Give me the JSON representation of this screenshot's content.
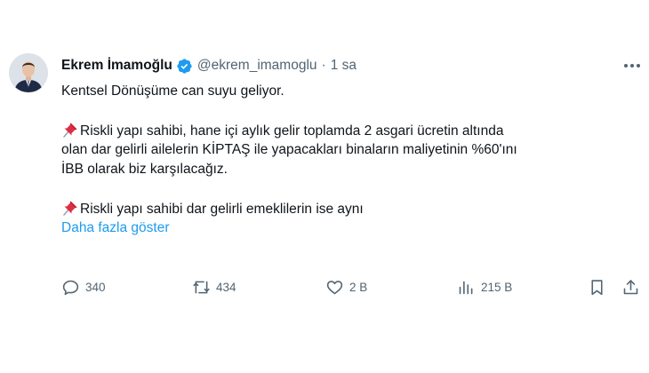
{
  "author": {
    "display_name": "Ekrem İmamoğlu",
    "handle": "@ekrem_imamoglu",
    "separator": "·",
    "time": "1 sa",
    "verified": true,
    "verified_color": "#1d9bf0"
  },
  "body": {
    "line1": "Kentsel Dönüşüme can suyu geliyor.",
    "line2": "Riskli yapı sahibi, hane içi aylık gelir toplamda 2 asgari ücretin altında",
    "line3": "olan dar gelirli ailelerin KİPTAŞ ile yapacakları binaların maliyetinin %60'ını",
    "line4": "İBB olarak biz karşılacağız.",
    "line5": "Riskli yapı sahibi dar gelirli emeklilerin ise aynı",
    "show_more": "Daha fazla göster",
    "pin_icon": "pushpin-icon"
  },
  "actions": {
    "reply_count": "340",
    "retweet_count": "434",
    "like_count": "2 B",
    "views_count": "215 B"
  },
  "colors": {
    "text": "#0f1419",
    "secondary": "#536471",
    "link": "#1d9bf0"
  }
}
